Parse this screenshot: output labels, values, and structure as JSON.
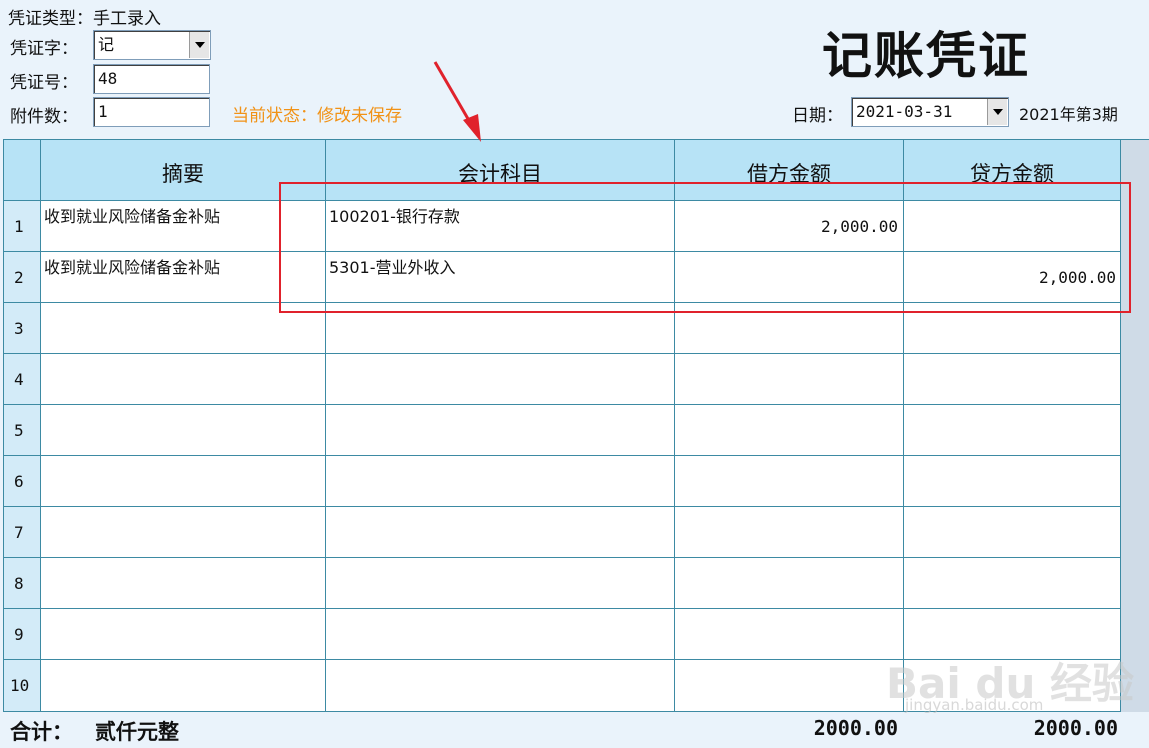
{
  "header": {
    "voucher_type_label": "凭证类型：",
    "voucher_type_value": "手工录入",
    "voucher_word_label": "凭证字：",
    "voucher_word_value": "记",
    "voucher_no_label": "凭证号：",
    "voucher_no_value": "48",
    "attachments_label": "附件数：",
    "attachments_value": "1",
    "status_text": "当前状态：修改未保存",
    "title": "记账凭证",
    "date_label": "日期：",
    "date_value": "2021-03-31",
    "period_text": "2021年第3期"
  },
  "table": {
    "columns": [
      "摘要",
      "会计科目",
      "借方金额",
      "贷方金额"
    ],
    "rows": [
      {
        "no": "1",
        "summary": "收到就业风险储备金补贴",
        "account": "100201-银行存款",
        "debit": "2,000.00",
        "credit": ""
      },
      {
        "no": "2",
        "summary": "收到就业风险储备金补贴",
        "account": "5301-营业外收入",
        "debit": "",
        "credit": "2,000.00"
      },
      {
        "no": "3",
        "summary": "",
        "account": "",
        "debit": "",
        "credit": ""
      },
      {
        "no": "4",
        "summary": "",
        "account": "",
        "debit": "",
        "credit": ""
      },
      {
        "no": "5",
        "summary": "",
        "account": "",
        "debit": "",
        "credit": ""
      },
      {
        "no": "6",
        "summary": "",
        "account": "",
        "debit": "",
        "credit": ""
      },
      {
        "no": "7",
        "summary": "",
        "account": "",
        "debit": "",
        "credit": ""
      },
      {
        "no": "8",
        "summary": "",
        "account": "",
        "debit": "",
        "credit": ""
      },
      {
        "no": "9",
        "summary": "",
        "account": "",
        "debit": "",
        "credit": ""
      },
      {
        "no": "10",
        "summary": "",
        "account": "",
        "debit": "",
        "credit": ""
      }
    ]
  },
  "totals": {
    "label": "合计：",
    "amount_in_words": "贰仟元整",
    "debit_total": "2000.00",
    "credit_total": "2000.00"
  },
  "watermark": {
    "brand": "Bai du 经验",
    "url": "jingyan.baidu.com"
  },
  "colors": {
    "status": "#f19216",
    "header_bg": "#b7e3f6",
    "grid_line": "#3d8aa3",
    "annotation": "#e0222c"
  }
}
